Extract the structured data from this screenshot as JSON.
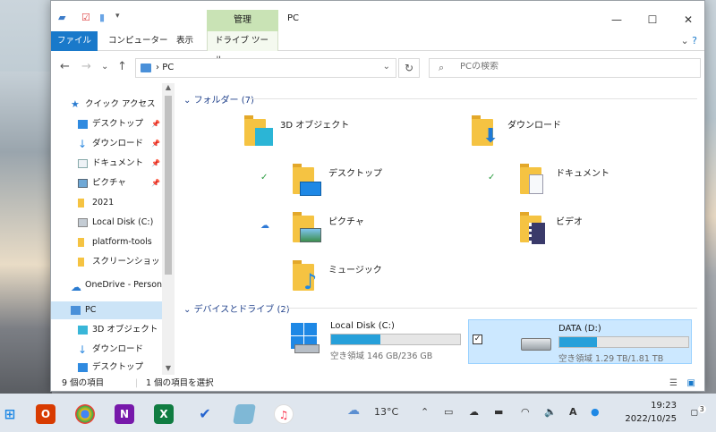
{
  "window": {
    "title": "PC",
    "context_tab": "管理",
    "controls": {
      "minimize": "—",
      "maximize": "☐",
      "close": "✕"
    }
  },
  "ribbon": {
    "tabs": [
      "ファイル",
      "コンピューター",
      "表示",
      "ドライブ ツール"
    ]
  },
  "address": {
    "path_sep": "›",
    "path": "PC",
    "search_placeholder": "PCの検索"
  },
  "navpane": {
    "items": [
      {
        "label": "クイック アクセス",
        "pinned": false
      },
      {
        "label": "デスクトップ",
        "pinned": true
      },
      {
        "label": "ダウンロード",
        "pinned": true
      },
      {
        "label": "ドキュメント",
        "pinned": true
      },
      {
        "label": "ピクチャ",
        "pinned": true
      },
      {
        "label": "2021",
        "pinned": false
      },
      {
        "label": "Local Disk (C:)",
        "pinned": false
      },
      {
        "label": "platform-tools",
        "pinned": false
      },
      {
        "label": "スクリーンショット",
        "pinned": false
      },
      {
        "label": "OneDrive - Person",
        "pinned": false
      },
      {
        "label": "PC",
        "pinned": false
      },
      {
        "label": "3D オブジェクト",
        "pinned": false
      },
      {
        "label": "ダウンロード",
        "pinned": false
      },
      {
        "label": "デスクトップ",
        "pinned": false
      }
    ]
  },
  "main": {
    "folders_header": "フォルダー (7)",
    "folders": [
      {
        "name": "3D オブジェクト",
        "icon": "cube-3d-icon",
        "sync": ""
      },
      {
        "name": "ダウンロード",
        "icon": "download-arrow-icon",
        "sync": ""
      },
      {
        "name": "デスクトップ",
        "icon": "desktop-icon",
        "sync": "✓"
      },
      {
        "name": "ドキュメント",
        "icon": "document-icon",
        "sync": "✓"
      },
      {
        "name": "ピクチャ",
        "icon": "picture-icon",
        "sync": "☁"
      },
      {
        "name": "ビデオ",
        "icon": "video-film-icon",
        "sync": ""
      },
      {
        "name": "ミュージック",
        "icon": "music-note-icon",
        "sync": ""
      }
    ],
    "drives_header": "デバイスとドライブ (2)",
    "drives": [
      {
        "name": "Local Disk (C:)",
        "free": "空き領域 146 GB/236 GB",
        "used_fraction": 0.38,
        "selected": false
      },
      {
        "name": "DATA (D:)",
        "free": "空き領域 1.29 TB/1.81 TB",
        "used_fraction": 0.29,
        "selected": true
      }
    ]
  },
  "status": {
    "count": "9 個の項目",
    "selected": "1 個の項目を選択"
  },
  "taskbar": {
    "weather": "13°C",
    "time": "19:23",
    "date": "2022/10/25",
    "notifications": "3",
    "ime": "A"
  }
}
